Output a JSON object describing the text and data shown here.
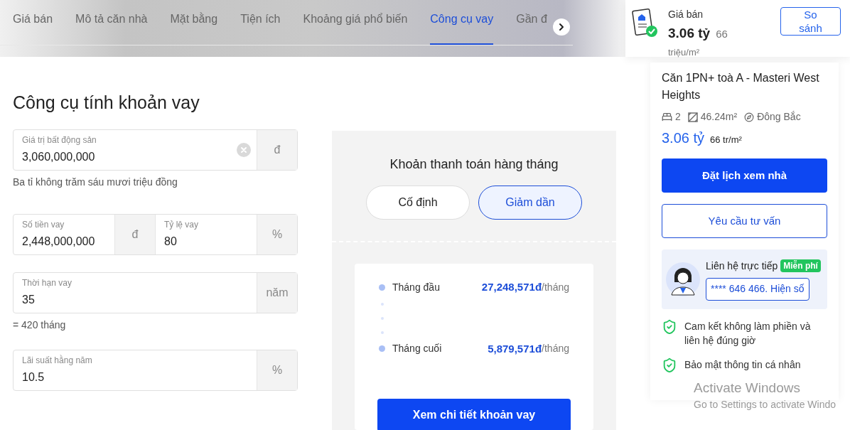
{
  "nav_tabs": [
    {
      "label": "Giá bán",
      "selected": false
    },
    {
      "label": "Mô tả căn nhà",
      "selected": false
    },
    {
      "label": "Mặt bằng",
      "selected": false
    },
    {
      "label": "Tiện ích",
      "selected": false
    },
    {
      "label": "Khoảng giá phổ biến",
      "selected": false
    },
    {
      "label": "Công cụ vay",
      "selected": true
    },
    {
      "label": "Gần đ",
      "selected": false
    }
  ],
  "price_summary": {
    "label": "Giá bán",
    "price": "3.06 tỷ",
    "unit_price": "66",
    "unit": "triệu/m²",
    "compare_button": "So sánh"
  },
  "calculator": {
    "title": "Công cụ tính khoản vay",
    "rows": [
      {
        "parts": [
          {
            "label": "Giá trị bất động sản",
            "value": "3,060,000,000",
            "unit": "đ",
            "clearable": true
          }
        ],
        "note": "Ba tỉ không trăm sáu mươi triệu đồng"
      },
      {
        "parts": [
          {
            "label": "Số tiền vay",
            "value": "2,448,000,000",
            "unit": "đ",
            "clearable": false
          },
          {
            "label": "Tỷ lệ vay",
            "value": "80",
            "unit": "%",
            "clearable": false
          }
        ]
      },
      {
        "parts": [
          {
            "label": "Thời hạn vay",
            "value": "35",
            "unit": "năm",
            "clearable": false
          }
        ],
        "note": "= 420 tháng"
      },
      {
        "parts": [
          {
            "label": "Lãi suất hằng năm",
            "value": "10.5",
            "unit": "%",
            "clearable": false
          }
        ]
      }
    ]
  },
  "payment": {
    "title": "Khoản thanh toán hàng tháng",
    "modes": [
      {
        "label": "Cố định",
        "selected": false
      },
      {
        "label": "Giảm dần",
        "selected": true
      }
    ],
    "schedule": [
      {
        "label": "Tháng đầu",
        "amount": "27,248,571đ",
        "per": "/tháng"
      },
      {
        "label": "Tháng cuối",
        "amount": "5,879,571đ",
        "per": "/tháng"
      }
    ],
    "detail_button": "Xem chi tiết khoản vay"
  },
  "listing": {
    "title": "Căn 1PN+ toà A - Masteri West Heights",
    "bedrooms": "2",
    "area": "46.24m²",
    "direction": "Đông Bắc",
    "price": "3.06 tỷ",
    "unit_price": "66 tr/m²",
    "primary_button": "Đặt lịch xem nhà",
    "secondary_button": "Yêu cầu tư vấn",
    "contact": {
      "label": "Liên hệ trực tiếp",
      "badge": "Miễn phí",
      "phone_button": "**** 646 466. Hiện số"
    },
    "assurances": [
      "Cam kết không làm phiền và liên hệ đúng giờ",
      "Bảo mật thông tin cá nhân"
    ]
  },
  "os_notice": {
    "title": "Activate Windows",
    "subtitle": "Go to Settings to activate Windo"
  }
}
